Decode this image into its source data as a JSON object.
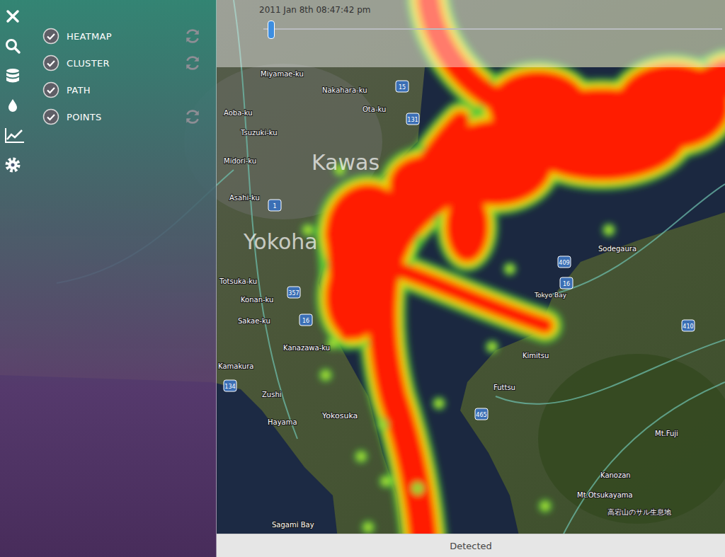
{
  "layers": [
    {
      "label": "HEATMAP",
      "checked": true,
      "refreshable": true
    },
    {
      "label": "CLUSTER",
      "checked": true,
      "refreshable": true
    },
    {
      "label": "PATH",
      "checked": true,
      "refreshable": false
    },
    {
      "label": "POINTS",
      "checked": true,
      "refreshable": true
    }
  ],
  "timeline": {
    "label": "2011 Jan 8th 08:47:42 pm",
    "level": 0.01
  },
  "map": {
    "labels": [
      "Miyamae-ku",
      "Nakahara-ku",
      "Ota-ku",
      "Aoba-ku",
      "Tsuzuki-ku",
      "Midori-ku",
      "Kawas",
      "Asahi-ku",
      "Yokoha",
      "Totsuka-ku",
      "Konan-ku",
      "Sakae-ku",
      "Kanazawa-ku",
      "Kamakura",
      "Zushi",
      "Hayama",
      "Yokosuka",
      "Sagami Bay",
      "Sodegaura",
      "Tokyo Bay",
      "Kimitsu",
      "Futtsu",
      "Mt.Fuji",
      "Kanozan",
      "Mt.Otsukayama",
      "高宕山のサル生息地"
    ],
    "shields": [
      "15",
      "131",
      "1",
      "357",
      "16",
      "409",
      "16",
      "410",
      "465",
      "134"
    ]
  },
  "status_bar": {
    "text": "Detected"
  }
}
